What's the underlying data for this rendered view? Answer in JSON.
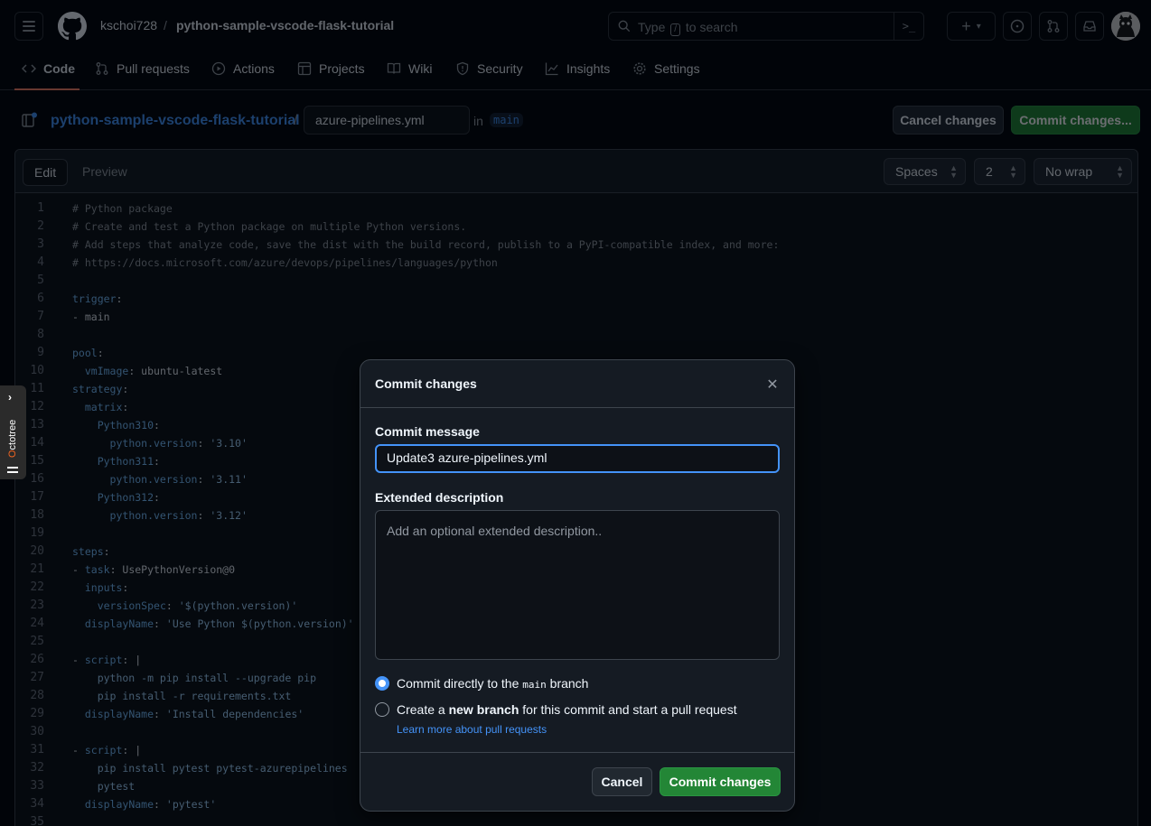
{
  "header": {
    "owner": "kschoi728",
    "separator": "/",
    "repo": "python-sample-vscode-flask-tutorial",
    "search_prefix": "Type",
    "search_key": "/",
    "search_suffix": "to search",
    "command_palette_glyph": ">_",
    "new_button_glyph": "+",
    "new_caret": "▾"
  },
  "repo_tabs": [
    {
      "label": "Code",
      "icon": "code-icon"
    },
    {
      "label": "Pull requests",
      "icon": "pull-request-icon"
    },
    {
      "label": "Actions",
      "icon": "play-icon"
    },
    {
      "label": "Projects",
      "icon": "table-icon"
    },
    {
      "label": "Wiki",
      "icon": "book-icon"
    },
    {
      "label": "Security",
      "icon": "shield-icon"
    },
    {
      "label": "Insights",
      "icon": "graph-icon"
    },
    {
      "label": "Settings",
      "icon": "gear-icon"
    }
  ],
  "breadcrumb": {
    "repo": "python-sample-vscode-flask-tutorial",
    "slash": "/",
    "filename": "azure-pipelines.yml",
    "in_label": "in",
    "branch": "main"
  },
  "actions": {
    "cancel": "Cancel changes",
    "commit": "Commit changes..."
  },
  "editor": {
    "tab_edit": "Edit",
    "tab_preview": "Preview",
    "indent_mode": "Spaces",
    "indent_size": "2",
    "wrap_mode": "No wrap",
    "lines": [
      {
        "n": "1",
        "parts": [
          [
            "c-com",
            "# Python package"
          ]
        ]
      },
      {
        "n": "2",
        "parts": [
          [
            "c-com",
            "# Create and test a Python package on multiple Python versions."
          ]
        ]
      },
      {
        "n": "3",
        "parts": [
          [
            "c-com",
            "# Add steps that analyze code, save the dist with the build record, publish to a PyPI-compatible index, and more:"
          ]
        ]
      },
      {
        "n": "4",
        "parts": [
          [
            "c-com",
            "# https://docs.microsoft.com/azure/devops/pipelines/languages/python"
          ]
        ]
      },
      {
        "n": "5",
        "parts": []
      },
      {
        "n": "6",
        "parts": [
          [
            "c-kb",
            "trigger"
          ],
          [
            "c-pl",
            ":"
          ]
        ]
      },
      {
        "n": "7",
        "parts": [
          [
            "c-pl",
            "- main"
          ]
        ]
      },
      {
        "n": "8",
        "parts": []
      },
      {
        "n": "9",
        "parts": [
          [
            "c-kb",
            "pool"
          ],
          [
            "c-pl",
            ":"
          ]
        ]
      },
      {
        "n": "10",
        "parts": [
          [
            "c-pl",
            "  "
          ],
          [
            "c-kb",
            "vmImage"
          ],
          [
            "c-pl",
            ": ubuntu-latest"
          ]
        ]
      },
      {
        "n": "11",
        "parts": [
          [
            "c-kb",
            "strategy"
          ],
          [
            "c-pl",
            ":"
          ]
        ]
      },
      {
        "n": "12",
        "parts": [
          [
            "c-pl",
            "  "
          ],
          [
            "c-kb",
            "matrix"
          ],
          [
            "c-pl",
            ":"
          ]
        ]
      },
      {
        "n": "13",
        "parts": [
          [
            "c-pl",
            "    "
          ],
          [
            "c-kb",
            "Python310"
          ],
          [
            "c-pl",
            ":"
          ]
        ]
      },
      {
        "n": "14",
        "parts": [
          [
            "c-pl",
            "      "
          ],
          [
            "c-kb",
            "python.version"
          ],
          [
            "c-pl",
            ": "
          ],
          [
            "c-str",
            "'3.10'"
          ]
        ]
      },
      {
        "n": "15",
        "parts": [
          [
            "c-pl",
            "    "
          ],
          [
            "c-kb",
            "Python311"
          ],
          [
            "c-pl",
            ":"
          ]
        ]
      },
      {
        "n": "16",
        "parts": [
          [
            "c-pl",
            "      "
          ],
          [
            "c-kb",
            "python.version"
          ],
          [
            "c-pl",
            ": "
          ],
          [
            "c-str",
            "'3.11'"
          ]
        ]
      },
      {
        "n": "17",
        "parts": [
          [
            "c-pl",
            "    "
          ],
          [
            "c-kb",
            "Python312"
          ],
          [
            "c-pl",
            ":"
          ]
        ]
      },
      {
        "n": "18",
        "parts": [
          [
            "c-pl",
            "      "
          ],
          [
            "c-kb",
            "python.version"
          ],
          [
            "c-pl",
            ": "
          ],
          [
            "c-str",
            "'3.12'"
          ]
        ]
      },
      {
        "n": "19",
        "parts": []
      },
      {
        "n": "20",
        "parts": [
          [
            "c-kb",
            "steps"
          ],
          [
            "c-pl",
            ":"
          ]
        ]
      },
      {
        "n": "21",
        "parts": [
          [
            "c-pl",
            "- "
          ],
          [
            "c-kb",
            "task"
          ],
          [
            "c-pl",
            ": UsePythonVersion@0"
          ]
        ]
      },
      {
        "n": "22",
        "parts": [
          [
            "c-pl",
            "  "
          ],
          [
            "c-kb",
            "inputs"
          ],
          [
            "c-pl",
            ":"
          ]
        ]
      },
      {
        "n": "23",
        "parts": [
          [
            "c-pl",
            "    "
          ],
          [
            "c-kb",
            "versionSpec"
          ],
          [
            "c-pl",
            ": "
          ],
          [
            "c-str",
            "'$(python.version)'"
          ]
        ]
      },
      {
        "n": "24",
        "parts": [
          [
            "c-pl",
            "  "
          ],
          [
            "c-kb",
            "displayName"
          ],
          [
            "c-pl",
            ": "
          ],
          [
            "c-str",
            "'Use Python $(python.version)'"
          ]
        ]
      },
      {
        "n": "25",
        "parts": []
      },
      {
        "n": "26",
        "parts": [
          [
            "c-pl",
            "- "
          ],
          [
            "c-kb",
            "script"
          ],
          [
            "c-pl",
            ": |"
          ]
        ]
      },
      {
        "n": "27",
        "parts": [
          [
            "c-str",
            "    python -m pip install --upgrade pip"
          ]
        ]
      },
      {
        "n": "28",
        "parts": [
          [
            "c-str",
            "    pip install -r requirements.txt"
          ]
        ]
      },
      {
        "n": "29",
        "parts": [
          [
            "c-pl",
            "  "
          ],
          [
            "c-kb",
            "displayName"
          ],
          [
            "c-pl",
            ": "
          ],
          [
            "c-str",
            "'Install dependencies'"
          ]
        ]
      },
      {
        "n": "30",
        "parts": []
      },
      {
        "n": "31",
        "parts": [
          [
            "c-pl",
            "- "
          ],
          [
            "c-kb",
            "script"
          ],
          [
            "c-pl",
            ": |"
          ]
        ]
      },
      {
        "n": "32",
        "parts": [
          [
            "c-str",
            "    pip install pytest pytest-azurepipelines"
          ]
        ]
      },
      {
        "n": "33",
        "parts": [
          [
            "c-str",
            "    pytest"
          ]
        ]
      },
      {
        "n": "34",
        "parts": [
          [
            "c-pl",
            "  "
          ],
          [
            "c-kb",
            "displayName"
          ],
          [
            "c-pl",
            ": "
          ],
          [
            "c-str",
            "'pytest'"
          ]
        ]
      },
      {
        "n": "35",
        "parts": []
      }
    ]
  },
  "octotree": {
    "label_prefix": "O",
    "label_rest": "ctotree",
    "toggle_glyph": "›"
  },
  "modal": {
    "title": "Commit changes",
    "close_glyph": "✕",
    "message_label": "Commit message",
    "message_value": "Update3 azure-pipelines.yml",
    "description_label": "Extended description",
    "description_placeholder": "Add an optional extended description..",
    "option_direct_prefix": "Commit directly to the ",
    "option_direct_branch": "main",
    "option_direct_suffix": " branch",
    "option_new_prefix": "Create a ",
    "option_new_bold": "new branch",
    "option_new_suffix": " for this commit and start a pull request",
    "learn_more": "Learn more about pull requests",
    "cancel": "Cancel",
    "commit": "Commit changes"
  },
  "colors": {
    "accent_blue": "#4493f8",
    "primary_green": "#238636",
    "tab_underline": "#f78166",
    "background": "#010409"
  }
}
